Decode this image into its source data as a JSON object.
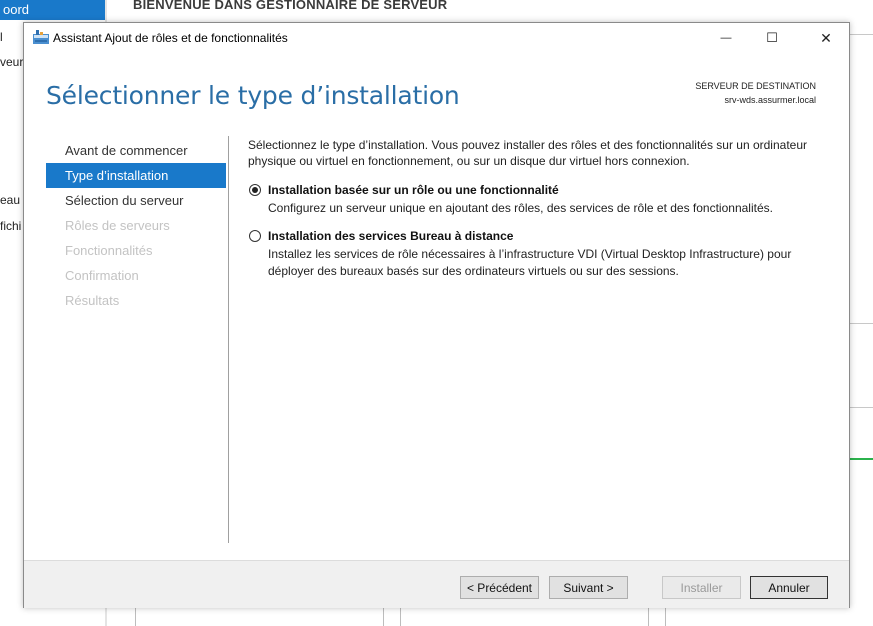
{
  "background": {
    "sidebar": {
      "selected_label": "oord",
      "items": [
        "l",
        "veur",
        "eau",
        "fichi"
      ]
    },
    "title": "BIENVENUE DANS GESTIONNAIRE DE SERVEUR"
  },
  "dialog": {
    "window_title": "Assistant Ajout de rôles et de fonctionnalités",
    "controls": {
      "minimize": "—",
      "maximize": "☐",
      "close": "✕"
    },
    "header_title": "Sélectionner le type d’installation",
    "destination": {
      "label": "SERVEUR DE DESTINATION",
      "server": "srv-wds.assurmer.local"
    },
    "nav": [
      {
        "label": "Avant de commencer",
        "state": "normal"
      },
      {
        "label": "Type d’installation",
        "state": "active"
      },
      {
        "label": "Sélection du serveur",
        "state": "normal"
      },
      {
        "label": "Rôles de serveurs",
        "state": "disabled"
      },
      {
        "label": "Fonctionnalités",
        "state": "disabled"
      },
      {
        "label": "Confirmation",
        "state": "disabled"
      },
      {
        "label": "Résultats",
        "state": "disabled"
      }
    ],
    "content": {
      "intro": "Sélectionnez le type d’installation. Vous pouvez installer des rôles et des fonctionnalités sur un ordinateur physique ou virtuel en fonctionnement, ou sur un disque dur virtuel hors connexion.",
      "options": [
        {
          "title": "Installation basée sur un rôle ou une fonctionnalité",
          "description": "Configurez un serveur unique en ajoutant des rôles, des services de rôle et des fonctionnalités.",
          "selected": true
        },
        {
          "title": "Installation des services Bureau à distance",
          "description": "Installez les services de rôle nécessaires à l’infrastructure VDI (Virtual Desktop Infrastructure) pour déployer des bureaux basés sur des ordinateurs virtuels ou sur des sessions.",
          "selected": false
        }
      ]
    },
    "buttons": {
      "previous": "< Précédent",
      "next": "Suivant >",
      "install": "Installer",
      "cancel": "Annuler"
    }
  },
  "colors": {
    "accent": "#1979ca",
    "header_text": "#2a6ea6",
    "footer_bg": "#f0f0f0"
  }
}
